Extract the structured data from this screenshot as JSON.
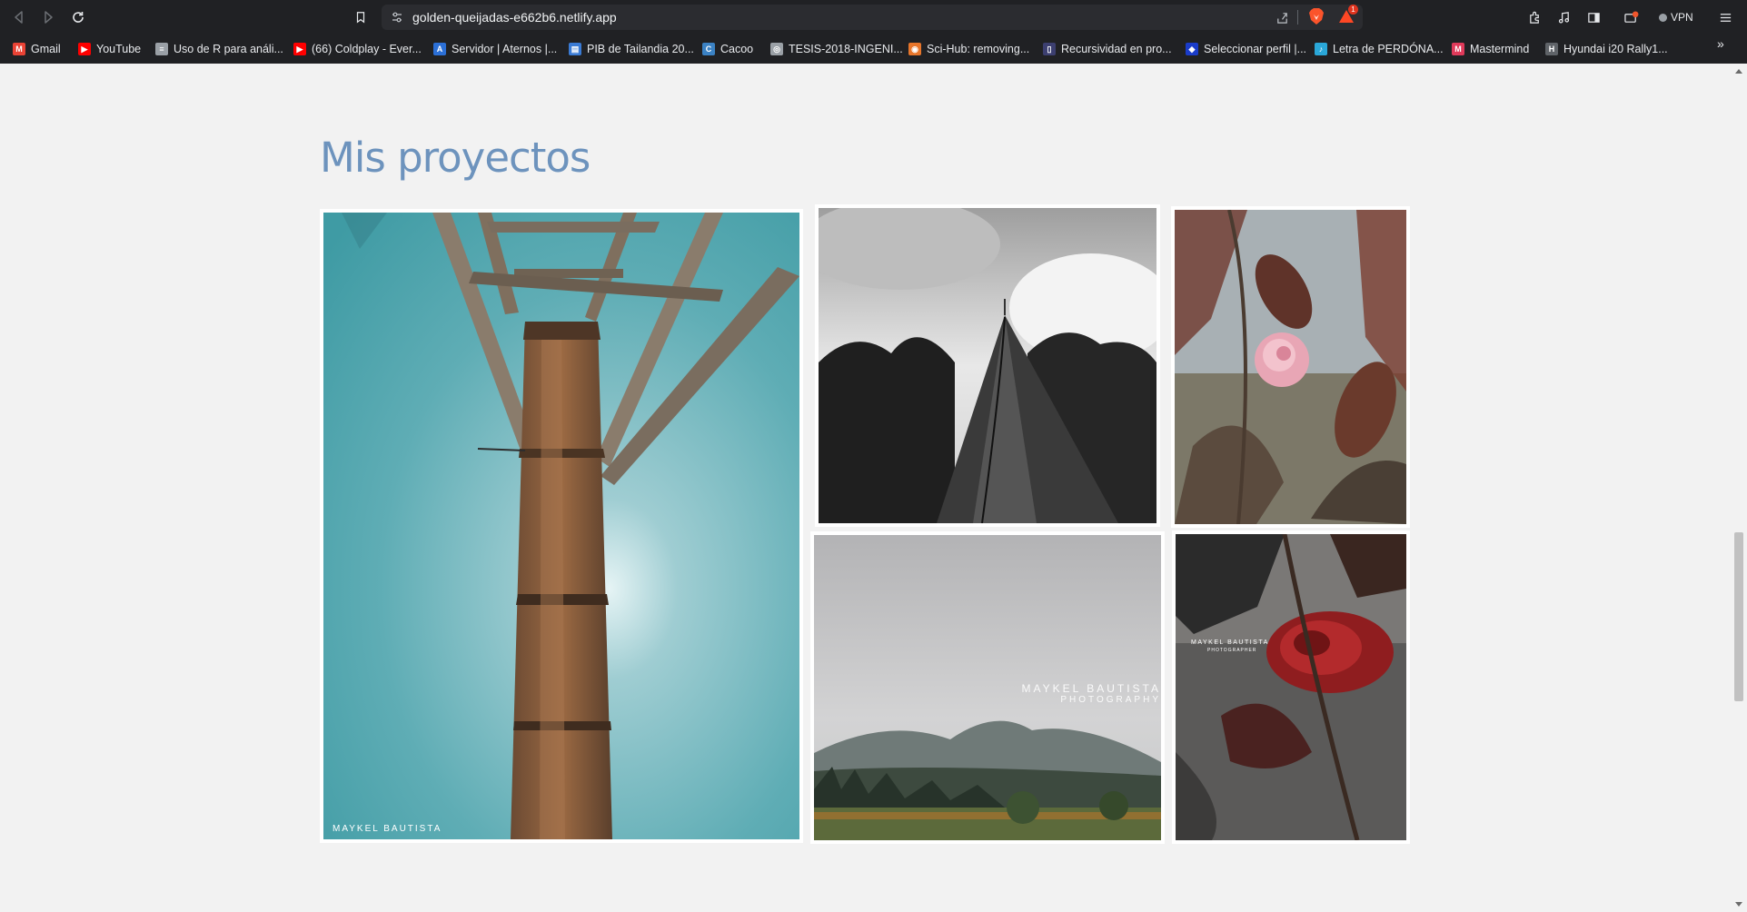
{
  "browser": {
    "url": "golden-queijadas-e662b6.netlify.app",
    "vpn_label": "VPN",
    "notification_count": "1",
    "bookmarks": [
      {
        "label": "Gmail",
        "icon": "gmail-icon",
        "color": "#ea4335"
      },
      {
        "label": "YouTube",
        "icon": "youtube-icon",
        "color": "#ff0000"
      },
      {
        "label": "Uso de R para análi...",
        "icon": "document-icon",
        "color": "#9aa0a6"
      },
      {
        "label": "(66) Coldplay - Ever...",
        "icon": "youtube-icon",
        "color": "#ff0000"
      },
      {
        "label": "Servidor | Aternos |...",
        "icon": "aternos-icon",
        "color": "#2b6fd6"
      },
      {
        "label": "PIB de Tailandia 20...",
        "icon": "chart-icon",
        "color": "#3a7bd5"
      },
      {
        "label": "Cacoo",
        "icon": "cacoo-icon",
        "color": "#3b82c4"
      },
      {
        "label": "TESIS-2018-INGENI...",
        "icon": "globe-icon",
        "color": "#9aa0a6"
      },
      {
        "label": "Sci-Hub: removing...",
        "icon": "scihub-icon",
        "color": "#e8762b"
      },
      {
        "label": "Recursividad en pro...",
        "icon": "page-icon",
        "color": "#3c3f70"
      },
      {
        "label": "Seleccionar perfil |...",
        "icon": "profile-icon",
        "color": "#1a3cc9"
      },
      {
        "label": "Letra de PERDÓNA...",
        "icon": "lyrics-icon",
        "color": "#2aa7d8"
      },
      {
        "label": "Mastermind",
        "icon": "mastermind-icon",
        "color": "#e03a5a"
      },
      {
        "label": "Hyundai i20 Rally1...",
        "icon": "hyundai-icon",
        "color": "#5f6368"
      }
    ],
    "more_bookmarks": "»"
  },
  "page": {
    "heading": "Mis proyectos",
    "photos": [
      {
        "name": "rusty-tower-photo",
        "watermark": "MAYKEL BAUTISTA",
        "watermark_sub": ""
      },
      {
        "name": "tree-trunk-photo",
        "watermark": "",
        "watermark_sub": ""
      },
      {
        "name": "pink-rose-photo",
        "watermark": "",
        "watermark_sub": ""
      },
      {
        "name": "foggy-mountain-photo",
        "watermark": "MAYKEL BAUTISTA",
        "watermark_sub": "PHOTOGRAPHY"
      },
      {
        "name": "red-rose-photo",
        "watermark": "MAYKEL BAUTISTA",
        "watermark_sub": "PHOTOGRAPHER"
      }
    ]
  },
  "colors": {
    "heading": "#6d93bd",
    "background": "#f2f2f2",
    "chrome": "#202124"
  }
}
